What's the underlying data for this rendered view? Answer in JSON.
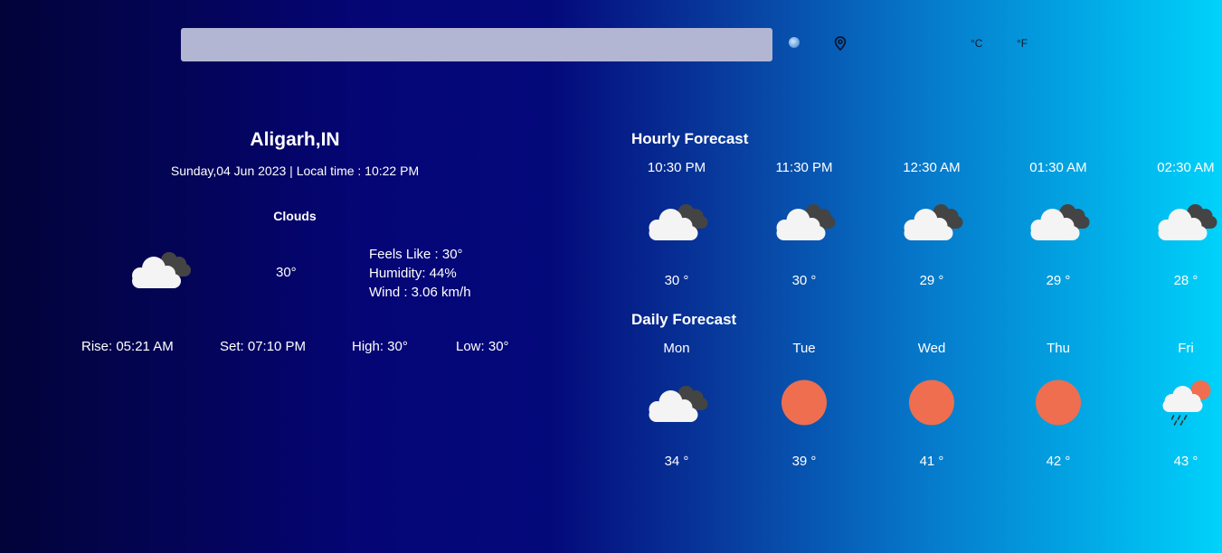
{
  "search": {
    "value": "",
    "placeholder": ""
  },
  "units": {
    "celsius": "°C",
    "fahrenheit": "°F"
  },
  "current": {
    "city": "Aligarh,IN",
    "datetime": "Sunday,04 Jun 2023 | Local time : 10:22 PM",
    "condition": "Clouds",
    "icon": "clouds-icon",
    "temp": "30°",
    "feels_like": "Feels Like : 30°",
    "humidity": "Humidity: 44%",
    "wind": "Wind : 3.06 km/h",
    "rise": "Rise: 05:21 AM",
    "set": "Set: 07:10 PM",
    "high": "High: 30°",
    "low": "Low: 30°"
  },
  "hourly": {
    "title": "Hourly Forecast",
    "items": [
      {
        "label": "10:30 PM",
        "temp": "30 °",
        "icon": "clouds-icon"
      },
      {
        "label": "11:30 PM",
        "temp": "30 °",
        "icon": "clouds-icon"
      },
      {
        "label": "12:30 AM",
        "temp": "29 °",
        "icon": "clouds-icon"
      },
      {
        "label": "01:30 AM",
        "temp": "29 °",
        "icon": "clouds-icon"
      },
      {
        "label": "02:30 AM",
        "temp": "28 °",
        "icon": "clouds-icon"
      }
    ]
  },
  "daily": {
    "title": "Daily Forecast",
    "items": [
      {
        "label": "Mon",
        "temp": "34 °",
        "icon": "clouds-icon"
      },
      {
        "label": "Tue",
        "temp": "39 °",
        "icon": "sun-icon"
      },
      {
        "label": "Wed",
        "temp": "41 °",
        "icon": "sun-icon"
      },
      {
        "label": "Thu",
        "temp": "42 °",
        "icon": "sun-icon"
      },
      {
        "label": "Fri",
        "temp": "43 °",
        "icon": "rain-icon"
      }
    ]
  },
  "colors": {
    "sun": "#ee6e4f",
    "cloud_light": "#f4f4f4",
    "cloud_dark": "#444444"
  }
}
